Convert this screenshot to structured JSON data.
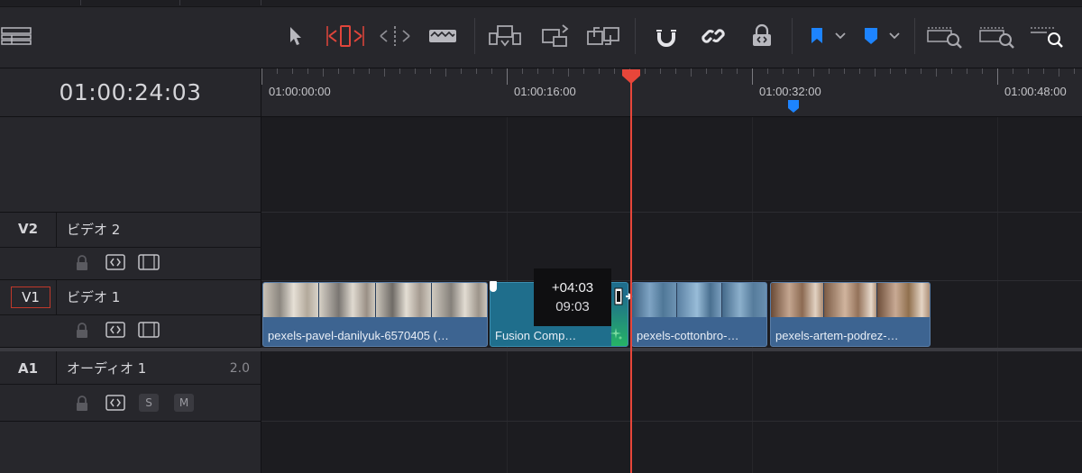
{
  "toolbar": {
    "icons": [
      "timeline-view-options-icon",
      "selection-mode-icon",
      "trim-edit-mode-icon",
      "dynamic-trim-mode-icon",
      "blade-edit-mode-icon",
      "insert-clip-icon",
      "overwrite-clip-icon",
      "replace-clip-icon",
      "snapping-icon",
      "linked-selection-icon",
      "position-lock-icon",
      "flag-icon",
      "marker-icon",
      "zoom-full-icon",
      "zoom-detail-icon",
      "zoom-custom-icon"
    ],
    "accent_red": "#e0453b",
    "accent_blue": "#1d84ff"
  },
  "timecode": "01:00:24:03",
  "ruler": {
    "labels": [
      "01:00:00:00",
      "01:00:16:00",
      "01:00:32:00",
      "01:00:48:00"
    ]
  },
  "tracks": {
    "v2": {
      "id": "V2",
      "name": "ビデオ 2"
    },
    "v1": {
      "id": "V1",
      "name": "ビデオ 1"
    },
    "a1": {
      "id": "A1",
      "name": "オーディオ 1",
      "channels": "2.0",
      "solo": "S",
      "mute": "M"
    }
  },
  "clips": [
    {
      "name": "pexels-pavel-danilyuk-6570405 (…",
      "type": "video"
    },
    {
      "name": "Fusion Comp…",
      "type": "fusion"
    },
    {
      "name": "pexels-cottonbro-…",
      "type": "video"
    },
    {
      "name": "pexels-artem-podrez-…",
      "type": "video"
    }
  ],
  "trim_tooltip": {
    "offset": "+04:03",
    "duration": "09:03"
  },
  "colors": {
    "playhead": "#e8463a",
    "clip_video": "#3d6491",
    "clip_fusion": "#1f6e8c",
    "marker": "#1d84ff"
  }
}
